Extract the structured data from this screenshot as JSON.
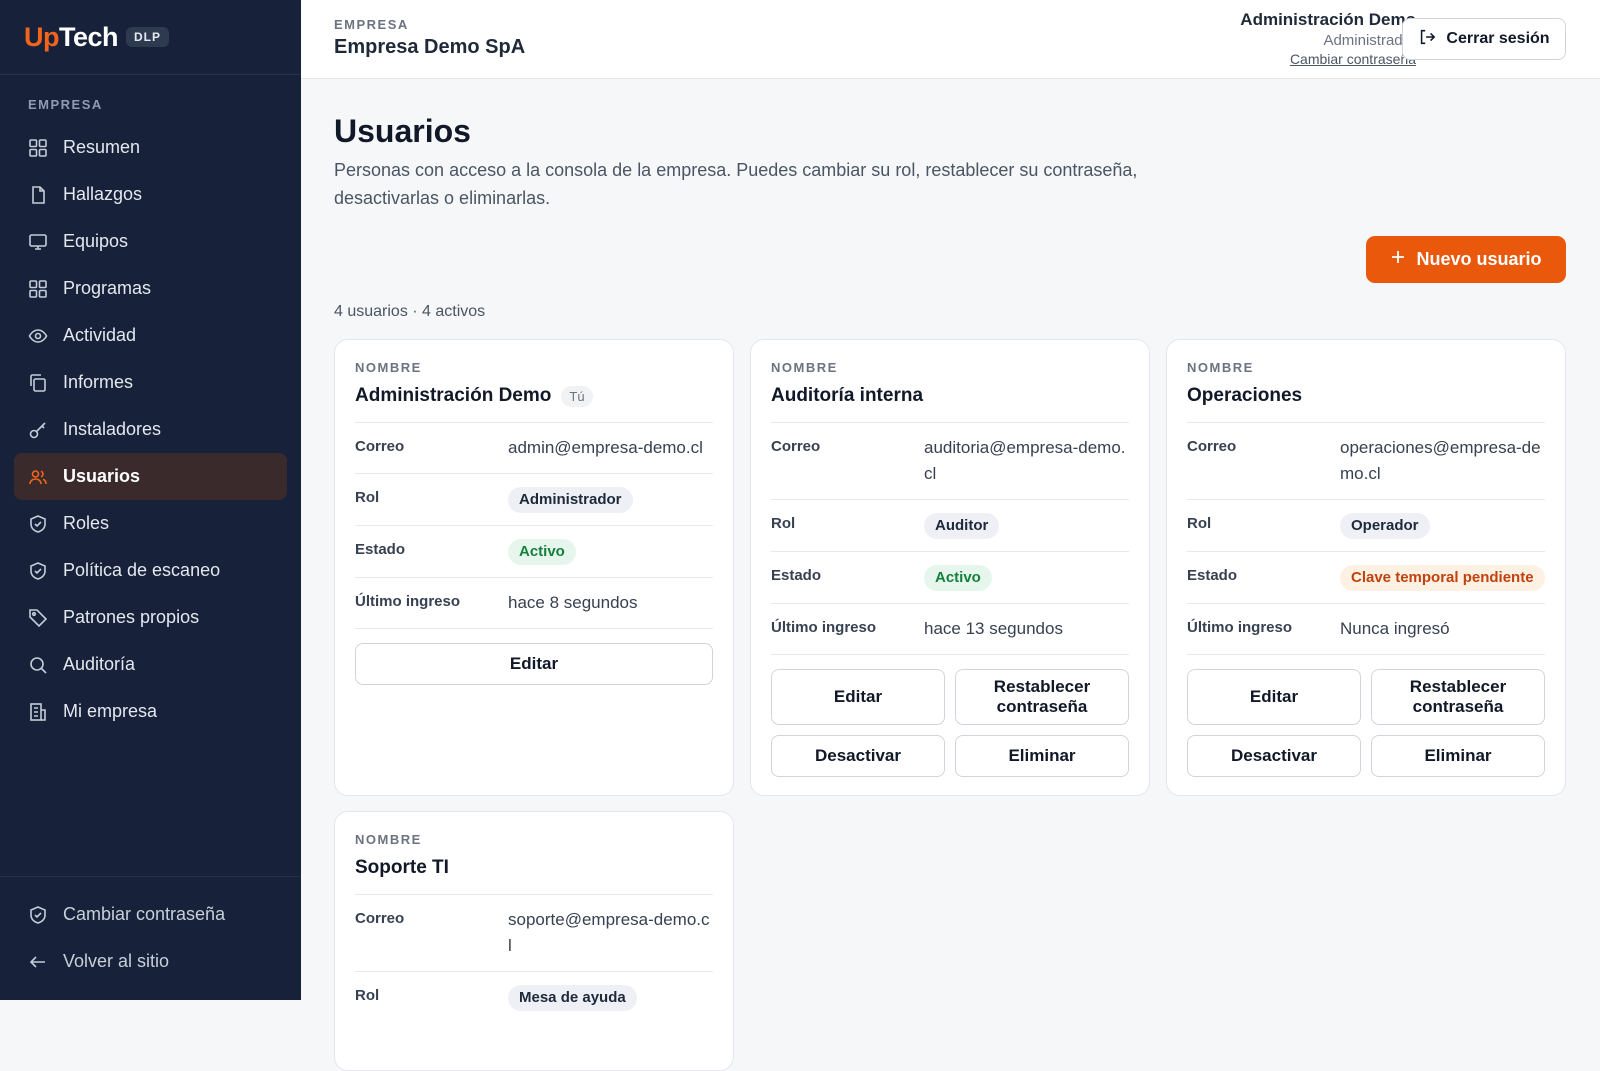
{
  "brand": {
    "logo_up": "Up",
    "logo_tech": "Tech",
    "badge": "DLP"
  },
  "sidebar": {
    "section_label": "EMPRESA",
    "items": [
      {
        "label": "Resumen",
        "icon": "grid-icon"
      },
      {
        "label": "Hallazgos",
        "icon": "file-icon"
      },
      {
        "label": "Equipos",
        "icon": "monitor-icon"
      },
      {
        "label": "Programas",
        "icon": "grid-icon"
      },
      {
        "label": "Actividad",
        "icon": "eye-icon"
      },
      {
        "label": "Informes",
        "icon": "copy-icon"
      },
      {
        "label": "Instaladores",
        "icon": "key-icon"
      },
      {
        "label": "Usuarios",
        "icon": "users-icon",
        "active": true
      },
      {
        "label": "Roles",
        "icon": "shield-icon"
      },
      {
        "label": "Política de escaneo",
        "icon": "shield-icon"
      },
      {
        "label": "Patrones propios",
        "icon": "tag-icon"
      },
      {
        "label": "Auditoría",
        "icon": "search-icon"
      },
      {
        "label": "Mi empresa",
        "icon": "building-icon"
      }
    ],
    "footer": [
      {
        "label": "Cambiar contraseña",
        "icon": "shield-icon"
      },
      {
        "label": "Volver al sitio",
        "icon": "arrow-left-icon"
      }
    ]
  },
  "header": {
    "company_label": "EMPRESA",
    "company_name": "Empresa Demo SpA",
    "user_name": "Administración Demo",
    "user_role": "Administrador",
    "change_password": "Cambiar contraseña",
    "logout": "Cerrar sesión"
  },
  "page": {
    "title": "Usuarios",
    "description": "Personas con acceso a la consola de la empresa. Puedes cambiar su rol, restablecer su contraseña, desactivarlas o eliminarlas.",
    "new_user": "Nuevo usuario",
    "count": "4 usuarios · 4 activos"
  },
  "labels": {
    "name": "NOMBRE",
    "email": "Correo",
    "role": "Rol",
    "status": "Estado",
    "last_login": "Último ingreso",
    "you": "Tú",
    "edit": "Editar",
    "reset": "Restablecer contraseña",
    "deactivate": "Desactivar",
    "delete": "Eliminar"
  },
  "users": [
    {
      "name": "Administración Demo",
      "email": "admin@empresa-demo.cl",
      "role": "Administrador",
      "status": "Activo",
      "last_login": "hace 8 segundos"
    },
    {
      "name": "Auditoría interna",
      "email": "auditoria@empresa-demo.cl",
      "role": "Auditor",
      "status": "Activo",
      "last_login": "hace 13 segundos"
    },
    {
      "name": "Operaciones",
      "email": "operaciones@empresa-demo.cl",
      "role": "Operador",
      "status": "Clave temporal pendiente",
      "last_login": "Nunca ingresó"
    },
    {
      "name": "Soporte TI",
      "email": "soporte@empresa-demo.cl",
      "role": "Mesa de ayuda"
    }
  ],
  "colors": {
    "accent": "#ea580c",
    "sidebar_bg": "#17223a",
    "active_bg": "#3a2a2b",
    "ok": "#15803d",
    "warn": "#c2410c"
  }
}
